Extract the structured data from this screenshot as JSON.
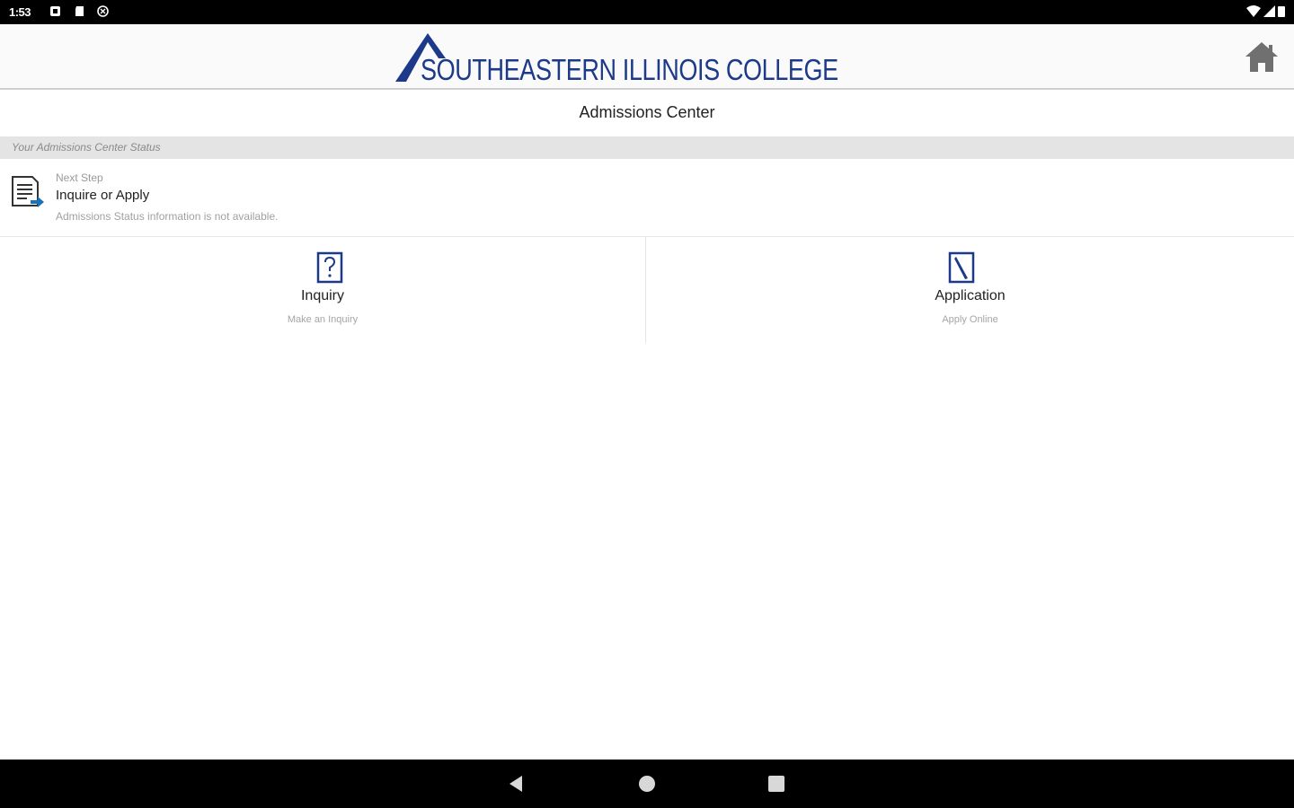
{
  "status_bar": {
    "time": "1:53",
    "icons": [
      "notification-icon",
      "sd-card-icon",
      "sync-icon",
      "wifi-icon",
      "signal-icon",
      "battery-icon"
    ]
  },
  "header": {
    "logo_text": "SOUTHEASTERN ILLINOIS COLLEGE",
    "home_icon": "home-icon"
  },
  "page": {
    "title": "Admissions Center"
  },
  "status_section": {
    "heading": "Your Admissions Center Status",
    "next_step_label": "Next Step",
    "next_step_value": "Inquire or Apply",
    "note": "Admissions Status information is not available."
  },
  "tiles": [
    {
      "title": "Inquiry",
      "subtitle": "Make an Inquiry",
      "icon": "question-document-icon"
    },
    {
      "title": "Application",
      "subtitle": "Apply Online",
      "icon": "pen-document-icon"
    }
  ],
  "nav": {
    "icons": [
      "back-icon",
      "home-circle-icon",
      "recents-icon"
    ]
  },
  "colors": {
    "brand_blue": "#1d3a8a",
    "accent_blue": "#1a73b8",
    "section_gray": "#e4e4e4"
  }
}
